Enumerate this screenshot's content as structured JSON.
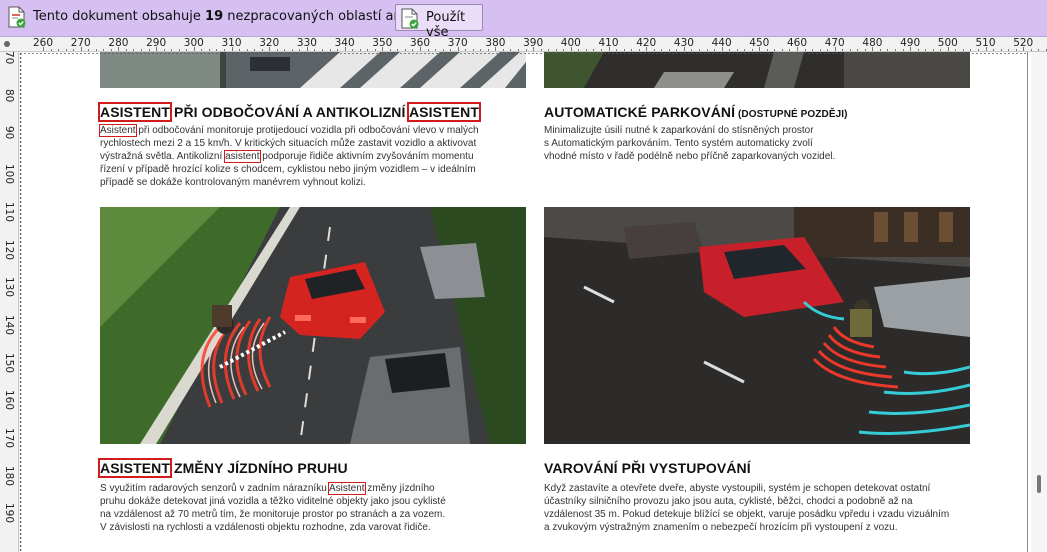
{
  "infobar": {
    "message_before": "Tento dokument obsahuje ",
    "count": "19",
    "message_after": " nezpracovaných oblastí anonymizace.",
    "apply_label": "Použít vše"
  },
  "ruler": {
    "h_ticks": [
      "260",
      "270",
      "280",
      "290",
      "300",
      "310",
      "320",
      "330",
      "340",
      "350",
      "360",
      "370",
      "380",
      "390",
      "400",
      "410",
      "420",
      "430",
      "440",
      "450",
      "460",
      "470",
      "480",
      "490",
      "500",
      "510",
      "520"
    ],
    "v_ticks": [
      "70",
      "80",
      "90",
      "100",
      "110",
      "120",
      "130",
      "140",
      "150",
      "160",
      "170",
      "180",
      "190"
    ]
  },
  "sections": {
    "turn_assist": {
      "title_word1": "ASISTENT",
      "title_mid": " PŘI ODBOČOVÁNÍ A ANTIKOLIZNÍ ",
      "title_word2": "ASISTENT",
      "lines": [
        {
          "a": "Asistent",
          "b": " při odbočování monitoruje protijedoucí vozidla při odbočování vlevo v malých"
        },
        {
          "b": "rychlostech mezi 2 a 15 km/h. V kritických situacích může zastavit vozidlo a aktivovat"
        },
        {
          "b": "výstražná světla. Antikolizní ",
          "a": "asistent",
          "c": " podporuje řidiče aktivním zvyšováním momentu"
        },
        {
          "b": "řízení v případě hrozící kolize s chodcem, cyklistou nebo jiným vozidlem – v ideálním"
        },
        {
          "b": "případě se dokáže kontrolovaným manévrem vyhnout kolizi."
        }
      ]
    },
    "auto_parking": {
      "title": "AUTOMATICKÉ PARKOVÁNÍ",
      "title_note": " (DOSTUPNÉ POZDĚJI)",
      "lines": [
        "Minimalizujte úsilí nutné k zaparkování do stísněných prostor",
        "s  Automatickým parkováním. Tento systém automaticky zvolí",
        "vhodné místo v řadě podélně nebo příčně zaparkovaných vozidel."
      ]
    },
    "lane_change": {
      "title_word": "ASISTENT",
      "title_rest": " ZMĚNY JÍZDNÍHO PRUHU",
      "lines": [
        {
          "b": "S využitím radarových senzorů v zadním nárazníku ",
          "a": "Asistent",
          "c": " změny jízdního"
        },
        {
          "b": "pruhu dokáže detekovat jiná vozidla a těžko viditelné objekty jako jsou cyklisté"
        },
        {
          "b": "na vzdálenost až 70 metrů tím, že monitoruje prostor po stranách a za vozem."
        },
        {
          "b": "V závislosti na rychlosti a vzdálenosti objektu rozhodne, zda varovat řidiče."
        }
      ]
    },
    "exit_warning": {
      "title": "VAROVÁNÍ PŘI VYSTUPOVÁNÍ",
      "lines": [
        "Když zastavíte a otevřete dveře, abyste vystoupili, systém je schopen detekovat ostatní",
        "účastníky silničního provozu jako jsou auta, cyklisté, běžci, chodci a podobně až na",
        "vzdálenost 35 m. Pokud detekuje blížící se objekt, varuje posádku vpředu i vzadu vizuálním",
        "a zvukovým výstražným znamením o nebezpečí hrozícím při vystoupení z  vozu."
      ]
    }
  },
  "colors": {
    "infobar_bg": "#d6c0f2",
    "redaction_outline": "#d31b1b"
  },
  "icons": [
    "document-check-icon",
    "apply-all-icon"
  ]
}
